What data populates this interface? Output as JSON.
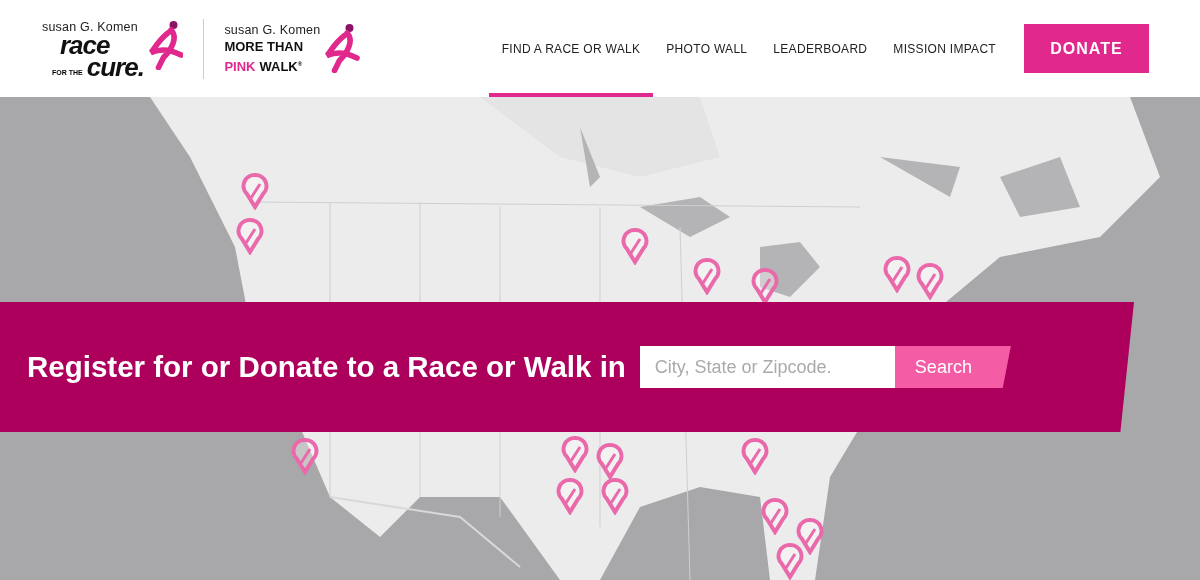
{
  "logo_race": {
    "brand": "susan G. Komen",
    "word_top": "race",
    "small": "FOR THE",
    "word_bottom": "cure."
  },
  "logo_walk": {
    "brand": "susan G. Komen",
    "line_1": "MORE THAN",
    "line_2_pink": "PINK",
    "line_2": "WALK$^{®}$"
  },
  "nav": [
    {
      "label": "FIND A RACE OR WALK",
      "selected": true
    },
    {
      "label": "PHOTO WALL",
      "selected": false
    },
    {
      "label": "LEADERBOARD",
      "selected": false
    },
    {
      "label": "MISSION IMPACT",
      "selected": false
    }
  ],
  "donate_button": "DONATE",
  "banner": {
    "headline": "Register for or Donate to a Race or Walk in",
    "search": {
      "placeholder": "City, State or Zipcode."
    },
    "search_button": "Search"
  }
}
